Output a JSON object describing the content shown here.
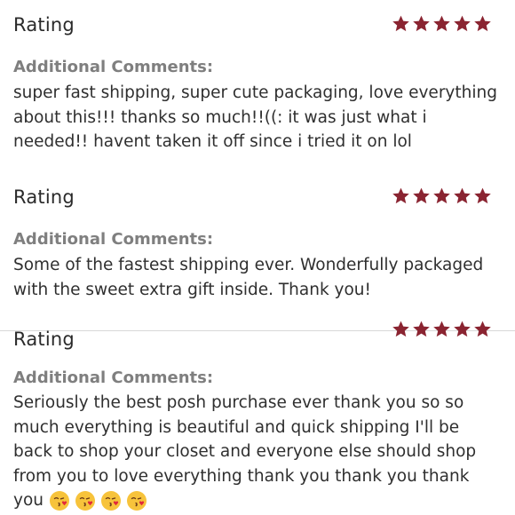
{
  "colors": {
    "star": "#8a2431",
    "label_gray": "#7f7f7f",
    "text": "#2f2f2f",
    "divider": "#d8d8d8"
  },
  "reviews": [
    {
      "rating_label": "Rating",
      "stars": 5,
      "comments_label": "Additional Comments:",
      "comment": "super fast shipping, super cute packaging, love everything about this!!! thanks so much!!((: it was just what i needed!! havent taken it off since i tried it on lol"
    },
    {
      "rating_label": "Rating",
      "stars": 5,
      "comments_label": "Additional Comments:",
      "comment": "Some of the fastest shipping ever. Wonderfully packaged with the sweet extra gift inside. Thank you!"
    },
    {
      "rating_label": "Rating",
      "stars": 5,
      "comments_label": "Additional Comments:",
      "comment": "Seriously the best posh purchase ever thank you so so much everything is beautiful and quick shipping I'll be back to shop your closet and everyone else should shop from you to love everything thank you thank you thank you",
      "emojis": [
        "kissing-heart-icon",
        "kissing-heart-icon",
        "kissing-heart-icon",
        "kissing-heart-icon"
      ]
    }
  ]
}
